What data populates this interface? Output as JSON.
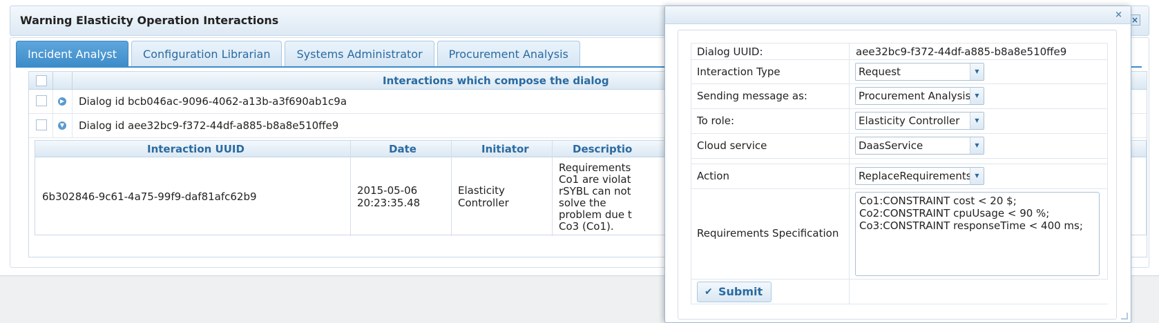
{
  "window": {
    "title": "Warning Elasticity Operation Interactions",
    "close_glyph": "×"
  },
  "tabs": [
    {
      "label": "Incident Analyst",
      "active": true
    },
    {
      "label": "Configuration Librarian",
      "active": false
    },
    {
      "label": "Systems Administrator",
      "active": false
    },
    {
      "label": "Procurement Analysis",
      "active": false
    }
  ],
  "grid": {
    "title": "Interactions which compose the dialog",
    "rows": [
      {
        "label": "Dialog id bcb046ac-9096-4062-a13b-a3f690ab1c9a",
        "expanded": false
      },
      {
        "label": "Dialog id aee32bc9-f372-44df-a885-b8a8e510ffe9",
        "expanded": true
      }
    ]
  },
  "sub_table": {
    "columns": [
      "Interaction UUID",
      "Date",
      "Initiator",
      "Descriptio"
    ],
    "row": {
      "uuid": "6b302846-9c61-4a75-99f9-daf81afc62b9",
      "date_line1": "2015-05-06",
      "date_line2": "20:23:35.48",
      "initiator_line1": "Elasticity",
      "initiator_line2": "Controller",
      "description_lines": [
        "Requirements",
        "Co1 are violat",
        "rSYBL can not",
        "solve the",
        "problem due t",
        "Co3 (Co1)."
      ]
    }
  },
  "dialog": {
    "close_glyph": "×",
    "fields": {
      "uuid_label": "Dialog UUID:",
      "uuid_value": "aee32bc9-f372-44df-a885-b8a8e510ffe9",
      "interaction_type_label": "Interaction Type",
      "interaction_type_value": "Request",
      "sending_as_label": "Sending message as:",
      "sending_as_value": "Procurement Analysis",
      "to_role_label": "To role:",
      "to_role_value": "Elasticity Controller",
      "cloud_service_label": "Cloud service",
      "cloud_service_value": "DaasService",
      "action_label": "Action",
      "action_value": "ReplaceRequirements",
      "requirements_label": "Requirements Specification",
      "requirements_lines": [
        "Co1:CONSTRAINT cost < 20 $;",
        "Co2:CONSTRAINT cpuUsage < 90 %;",
        "Co3:CONSTRAINT responseTime < 400 ms;"
      ]
    },
    "submit_label": "Submit",
    "colors": {
      "accent": "#3c8cc9",
      "link_text": "#2a6aa0"
    }
  }
}
